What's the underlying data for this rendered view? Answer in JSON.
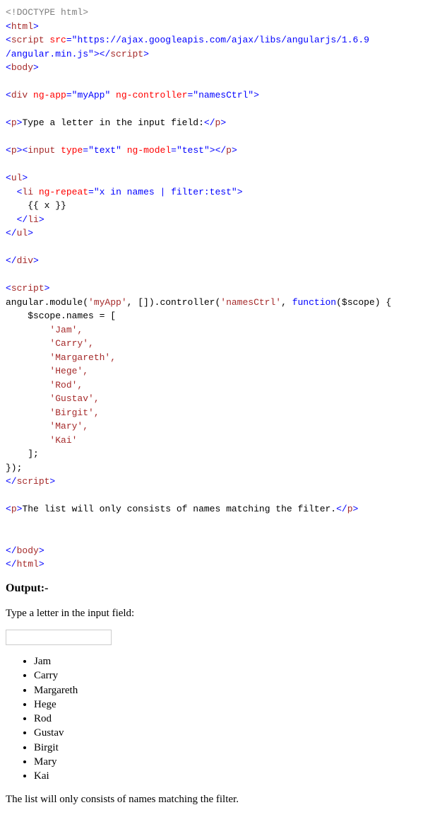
{
  "code": {
    "doctype_open": "<!",
    "doctype_text": "DOCTYPE html",
    "doctype_close": ">",
    "lt": "<",
    "gt": ">",
    "lt_slash": "</",
    "html": "html",
    "script": "script",
    "src_attr": " src",
    "eq": "=",
    "src_val": "\"https://ajax.googleapis.com/ajax/libs/angularjs/1.6.9\n/angular.min.js\"",
    "close_tag_inline": "></",
    "body": "body",
    "div": "div",
    "ng_app_attr": " ng-app",
    "ng_app_val": "\"myApp\"",
    "ng_controller_attr": " ng-controller",
    "ng_controller_val": "\"namesCtrl\"",
    "p": "p",
    "p1_text": "Type a letter in the input field:",
    "input": "input",
    "type_attr": " type",
    "type_val": "\"text\"",
    "ng_model_attr": " ng-model",
    "ng_model_val": "\"test\"",
    "ul": "ul",
    "li": "li",
    "ng_repeat_attr": " ng-repeat",
    "ng_repeat_val": "\"x in names | filter:test\"",
    "li_body": "    {{ x }}",
    "indent2": "  ",
    "js_line1": "angular.module(",
    "js_str1": "'myApp'",
    "js_mid1": ", []).controller(",
    "js_str2": "'namesCtrl'",
    "js_mid2": ", ",
    "js_func": "function",
    "js_tail": "($scope) {",
    "js_line2": "    $scope.names = [",
    "js_names": [
      "        'Jam',",
      "        'Carry',",
      "        'Margareth',",
      "        'Hege',",
      "        'Rod',",
      "        'Gustav',",
      "        'Birgit',",
      "        'Mary',",
      "        'Kai'"
    ],
    "js_close_arr": "    ];",
    "js_close_fn": "});",
    "p2_text": "The list will only consists of names matching the filter."
  },
  "output": {
    "heading": "Output:-",
    "prompt": "Type a letter in the input field:",
    "placeholder": "",
    "names": [
      "Jam",
      "Carry",
      "Margareth",
      "Hege",
      "Rod",
      "Gustav",
      "Birgit",
      "Mary",
      "Kai"
    ],
    "footer": "The list will only consists of names matching the filter."
  }
}
